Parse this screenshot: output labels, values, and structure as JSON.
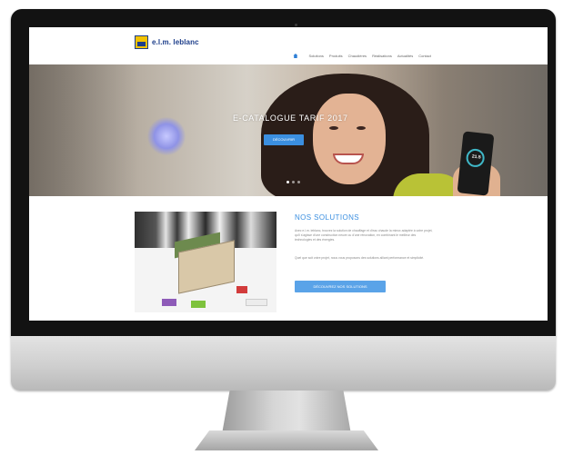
{
  "site": {
    "logo_text": "e.l.m. leblanc",
    "nav": [
      "Solutions",
      "Produits",
      "Chaudières",
      "Réalisations",
      "Actualités",
      "Contact"
    ],
    "nav_icon": "home-icon"
  },
  "hero": {
    "title": "E-CATALOGUE TARIF 2017",
    "button_label": "DÉCOUVRIR",
    "phone_temperature": "21.5",
    "slide_count": 3,
    "active_slide": 1
  },
  "solutions": {
    "title": "NOS SOLUTIONS",
    "paragraph_1": "Avec e.l.m. leblanc, trouvez la solution de chauffage et d'eau chaude la mieux adaptée à votre projet, qu'il s'agisse d'une construction neuve ou d'une rénovation, en combinant le meilleur des technologies et des énergies.",
    "paragraph_2": "Quel que soit votre projet, nous vous proposons des solutions alliant performance et simplicité.",
    "button_label": "DÉCOUVREZ NOS SOLUTIONS"
  },
  "colors": {
    "accent": "#3b8fe0",
    "brand_blue": "#1d3e8a",
    "brand_yellow": "#f2c200",
    "bezel": "#121212"
  }
}
